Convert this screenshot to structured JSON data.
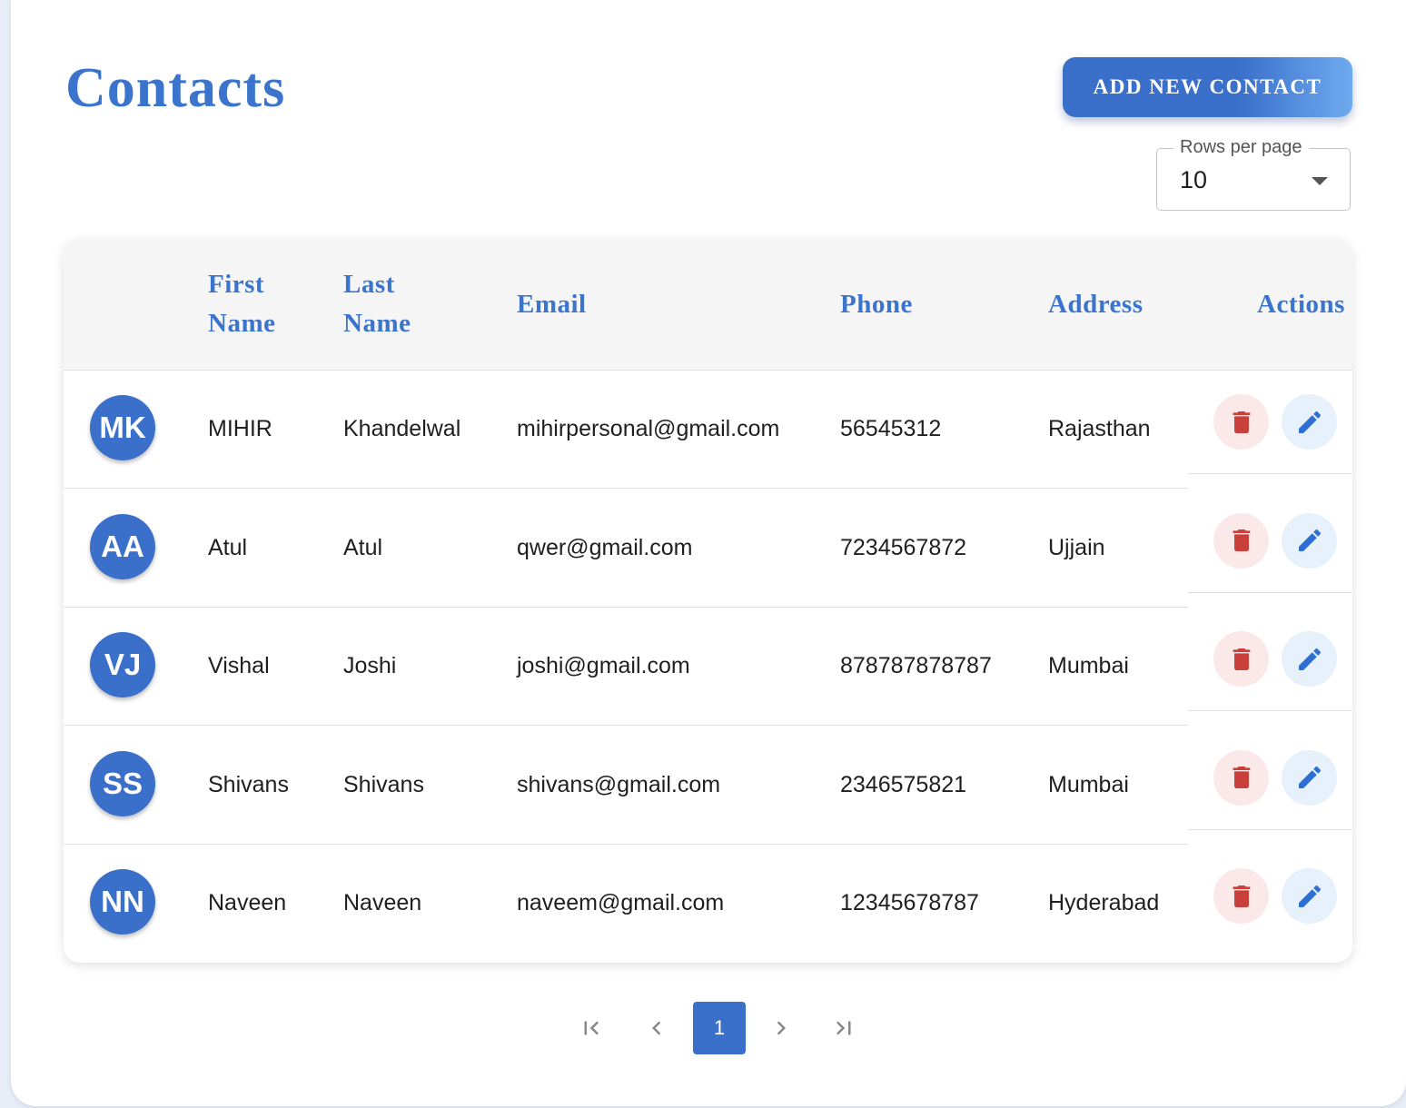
{
  "page": {
    "title": "Contacts",
    "add_button_label": "ADD NEW CONTACT"
  },
  "rows_per_page": {
    "label": "Rows per page",
    "value": "10"
  },
  "table": {
    "headers": {
      "first_name": "First Name",
      "last_name": "Last Name",
      "email": "Email",
      "phone": "Phone",
      "address": "Address",
      "actions": "Actions"
    },
    "rows": [
      {
        "initials": "MK",
        "first_name": "MIHIR",
        "last_name": "Khandelwal",
        "email": "mihirpersonal@gmail.com",
        "phone": "56545312",
        "address": "Rajasthan"
      },
      {
        "initials": "AA",
        "first_name": "Atul",
        "last_name": "Atul",
        "email": "qwer@gmail.com",
        "phone": "7234567872",
        "address": "Ujjain"
      },
      {
        "initials": "VJ",
        "first_name": "Vishal",
        "last_name": "Joshi",
        "email": "joshi@gmail.com",
        "phone": "878787878787",
        "address": "Mumbai"
      },
      {
        "initials": "SS",
        "first_name": "Shivans",
        "last_name": "Shivans",
        "email": "shivans@gmail.com",
        "phone": "2346575821",
        "address": "Mumbai"
      },
      {
        "initials": "NN",
        "first_name": "Naveen",
        "last_name": "Naveen",
        "email": "naveem@gmail.com",
        "phone": "12345678787",
        "address": "Hyderabad"
      }
    ]
  },
  "pagination": {
    "current_page": "1"
  },
  "icons": {
    "delete": "trash-icon",
    "edit": "pencil-icon",
    "first_page": "first-page-icon",
    "prev_page": "chevron-left-icon",
    "next_page": "chevron-right-icon",
    "last_page": "last-page-icon"
  },
  "colors": {
    "accent": "#3a74cc",
    "delete_icon": "#c9403a",
    "delete_bg": "#fbe9e9",
    "edit_icon": "#2f6fd1",
    "edit_bg": "#e6f1fc"
  }
}
